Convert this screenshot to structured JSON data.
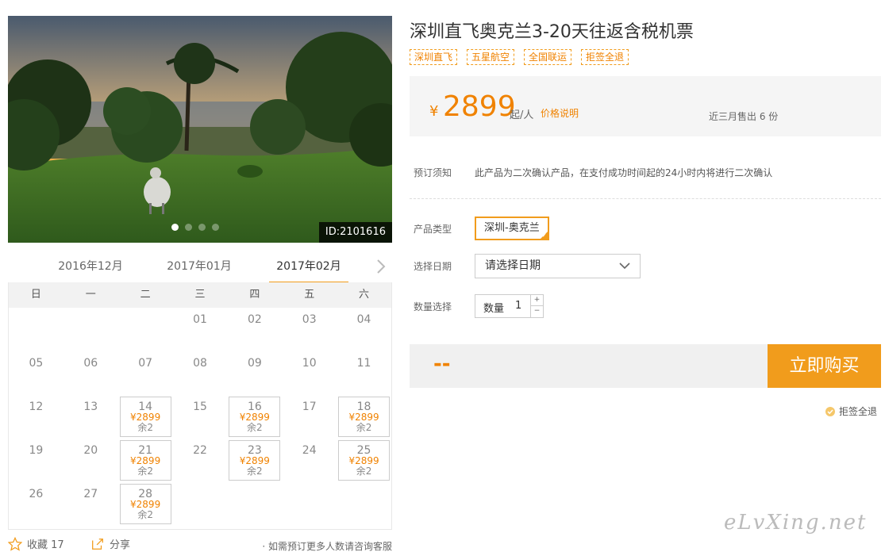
{
  "photo": {
    "id_label": "ID:2101616",
    "dots_count": 4,
    "active_dot": 0
  },
  "calendar": {
    "months": [
      "2016年12月",
      "2017年01月",
      "2017年02月"
    ],
    "active_month": "2017年02月",
    "weekdays": [
      "日",
      "一",
      "二",
      "三",
      "四",
      "五",
      "六"
    ],
    "weeks": [
      [
        null,
        null,
        null,
        {
          "day": "01"
        },
        {
          "day": "02"
        },
        {
          "day": "03"
        },
        {
          "day": "04"
        }
      ],
      [
        {
          "day": "05"
        },
        {
          "day": "06"
        },
        {
          "day": "07"
        },
        {
          "day": "08"
        },
        {
          "day": "09"
        },
        {
          "day": "10"
        },
        {
          "day": "11"
        }
      ],
      [
        {
          "day": "12"
        },
        {
          "day": "13"
        },
        {
          "day": "14",
          "price": "¥2899",
          "remain": "余2"
        },
        {
          "day": "15"
        },
        {
          "day": "16",
          "price": "¥2899",
          "remain": "余2"
        },
        {
          "day": "17"
        },
        {
          "day": "18",
          "price": "¥2899",
          "remain": "余2"
        }
      ],
      [
        {
          "day": "19"
        },
        {
          "day": "20"
        },
        {
          "day": "21",
          "price": "¥2899",
          "remain": "余2"
        },
        {
          "day": "22"
        },
        {
          "day": "23",
          "price": "¥2899",
          "remain": "余2"
        },
        {
          "day": "24"
        },
        {
          "day": "25",
          "price": "¥2899",
          "remain": "余2"
        }
      ],
      [
        {
          "day": "26"
        },
        {
          "day": "27"
        },
        {
          "day": "28",
          "price": "¥2899",
          "remain": "余2"
        },
        null,
        null,
        null,
        null
      ]
    ]
  },
  "bottom": {
    "favorite_label": "收藏 17",
    "share_label": "分享",
    "consult_text": "· 如需预订更多人数请咨询客服"
  },
  "product": {
    "title": "深圳直飞奥克兰3-20天往返含税机票",
    "tags": [
      "深圳直飞",
      "五星航空",
      "全国联运",
      "拒签全退"
    ],
    "price_currency": "¥",
    "price_amount": "2899",
    "price_per": "起/人",
    "price_explain": "价格说明",
    "sold_text": "近三月售出 6 份",
    "notice_label": "预订须知",
    "notice_text": "此产品为二次确认产品，在支付成功时间起的24小时内将进行二次确认",
    "type_label": "产品类型",
    "type_value": "深圳-奥克兰",
    "date_label": "选择日期",
    "date_placeholder": "请选择日期",
    "qty_label": "数量选择",
    "qty_inner_label": "数量",
    "qty_value": "1",
    "total_text": "--",
    "buy_label": "立即购买",
    "refund_text": "拒签全退"
  },
  "watermark": "eLvXing.net",
  "colors": {
    "accent": "#f19c1c",
    "price": "#f08200"
  }
}
